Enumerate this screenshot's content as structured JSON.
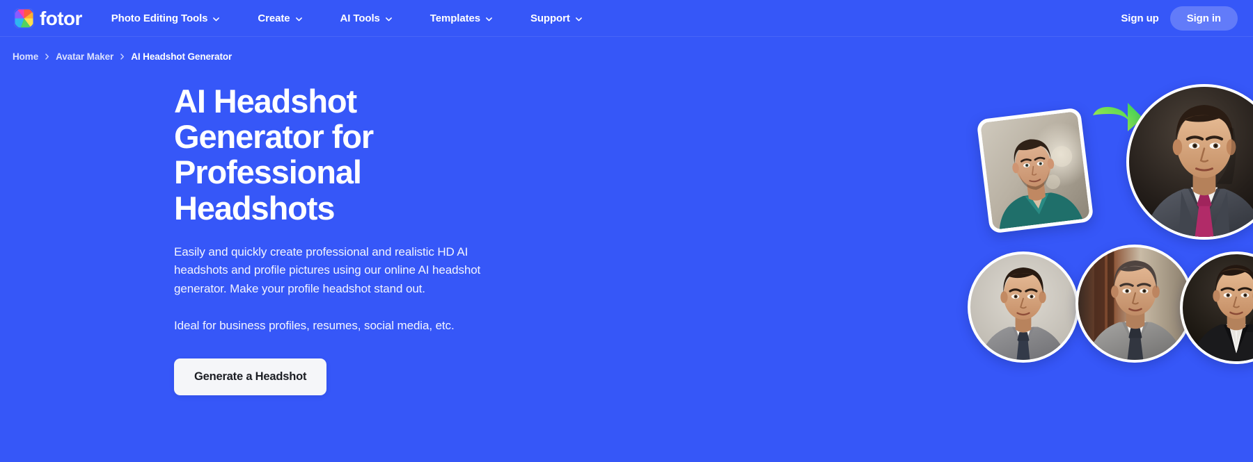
{
  "brand": {
    "name": "fotor",
    "logo_icon": "fotor-color-wheel-icon"
  },
  "header": {
    "nav": [
      {
        "label": "Photo Editing Tools",
        "icon": "chevron-down-icon"
      },
      {
        "label": "Create",
        "icon": "chevron-down-icon"
      },
      {
        "label": "AI Tools",
        "icon": "chevron-down-icon"
      },
      {
        "label": "Templates",
        "icon": "chevron-down-icon"
      },
      {
        "label": "Support",
        "icon": "chevron-down-icon"
      }
    ],
    "sign_up": "Sign up",
    "sign_in": "Sign in"
  },
  "breadcrumb": {
    "separator_icon": "chevron-right-icon",
    "items": [
      {
        "label": "Home",
        "current": false
      },
      {
        "label": "Avatar Maker",
        "current": false
      },
      {
        "label": "AI Headshot Generator",
        "current": true
      }
    ]
  },
  "hero": {
    "title_line1": "AI Headshot Generator for",
    "title_line2": "Professional Headshots",
    "description": "Easily and quickly create professional and realistic HD AI headshots and profile pictures using our online AI headshot generator. Make your profile headshot stand out.",
    "description2": "Ideal for business profiles, resumes, social media, etc.",
    "cta_label": "Generate a Headshot"
  },
  "artwork": {
    "source_photo": {
      "name": "original-casual-portrait",
      "alt": "Casual photo of a young man in a teal shirt"
    },
    "arrow": {
      "name": "green-transform-arrow-icon",
      "color_start": "#c2f24d",
      "color_end": "#36d35a"
    },
    "generated_headshots": [
      {
        "name": "generated-headshot-main",
        "alt": "Man in dark suit with magenta tie on dark background"
      },
      {
        "name": "generated-headshot-1",
        "alt": "Man in light grey suit on beige background"
      },
      {
        "name": "generated-headshot-2",
        "alt": "Man in grey suit with dark tie indoors"
      },
      {
        "name": "generated-headshot-3",
        "alt": "Man in black blazer on dark background"
      }
    ]
  },
  "theme": {
    "background": "#3657f8",
    "accent_green": "#5fdc53",
    "cta_background": "#f5f6f9",
    "cta_text": "#1b1d23"
  }
}
